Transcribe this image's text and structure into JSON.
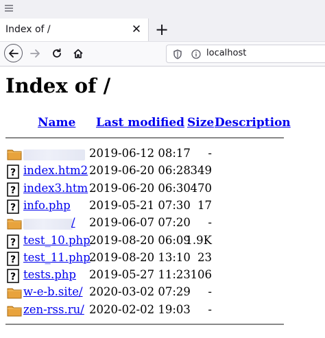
{
  "browser": {
    "tab_title": "Index of /",
    "tab_close_glyph": "✕",
    "new_tab_glyph": "+",
    "url": "localhost"
  },
  "page": {
    "title": "Index of /",
    "columns": {
      "name": "Name",
      "modified": "Last modified",
      "size": "Size",
      "description": "Description"
    },
    "rows": [
      {
        "name": "",
        "redacted": true,
        "icon": "folder-icon",
        "modified": "2019-06-12 08:17",
        "size": "-"
      },
      {
        "name": "index.htm2",
        "icon": "unknown-file-icon",
        "modified": "2019-06-20 06:28",
        "size": "349"
      },
      {
        "name": "index3.htm",
        "icon": "unknown-file-icon",
        "modified": "2019-06-20 06:30",
        "size": "470"
      },
      {
        "name": "info.php",
        "icon": "unknown-file-icon",
        "modified": "2019-05-21 07:30",
        "size": "17"
      },
      {
        "name": "/",
        "redacted": true,
        "icon": "folder-icon",
        "modified": "2019-06-07 07:20",
        "size": "-"
      },
      {
        "name": "test_10.php",
        "icon": "unknown-file-icon",
        "modified": "2019-08-20 06:09",
        "size": "1.9K"
      },
      {
        "name": "test_11.php",
        "icon": "unknown-file-icon",
        "modified": "2019-08-20 13:10",
        "size": "23"
      },
      {
        "name": "tests.php",
        "icon": "unknown-file-icon",
        "modified": "2019-05-27 11:23",
        "size": "106"
      },
      {
        "name": "w-e-b.site/",
        "icon": "folder-icon",
        "modified": "2020-03-02 07:29",
        "size": "-"
      },
      {
        "name": "zen-rss.ru/",
        "icon": "folder-icon",
        "modified": "2020-02-02 19:03",
        "size": "-"
      }
    ]
  },
  "colors": {
    "link": "#0000ee",
    "folder": "#e8a33d",
    "chrome_bg": "#f0f0f4"
  }
}
